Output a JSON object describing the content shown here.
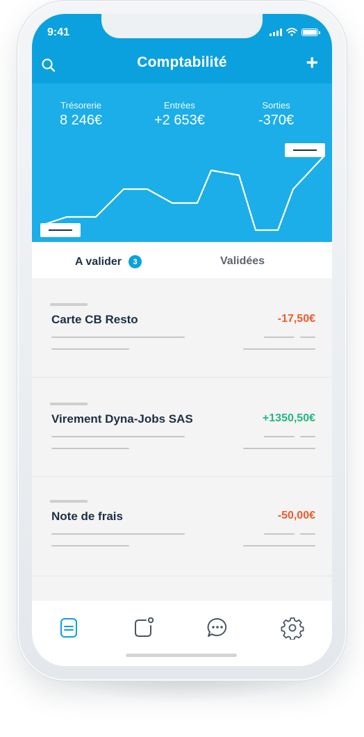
{
  "status_bar": {
    "time": "9:41"
  },
  "header": {
    "title": "Comptabilité"
  },
  "icons": {
    "search": "search-icon",
    "add": "plus-icon",
    "signal": "signal-icon",
    "wifi": "wifi-icon",
    "battery": "battery-icon"
  },
  "summary": {
    "tresorerie": {
      "label": "Trésorerie",
      "value": "8 246€"
    },
    "entrees": {
      "label": "Entrées",
      "value": "+2 653€"
    },
    "sorties": {
      "label": "Sorties",
      "value": "-370€"
    }
  },
  "tabs": {
    "active": {
      "label": "A valider",
      "badge": "3"
    },
    "inactive": {
      "label": "Validées"
    }
  },
  "transactions": [
    {
      "title": "Carte CB Resto",
      "amount": "-17,50€",
      "type": "negative"
    },
    {
      "title": "Virement Dyna-Jobs SAS",
      "amount": "+1350,50€",
      "type": "positive"
    },
    {
      "title": "Note de frais",
      "amount": "-50,00€",
      "type": "negative"
    }
  ],
  "bottom_nav": [
    "document-icon",
    "notification-square-icon",
    "chat-bubble-icon",
    "settings-gear-icon"
  ],
  "colors": {
    "header": "#0aa1de",
    "chart_bg": "#1baee8",
    "negative": "#f15a29",
    "positive": "#21b87d",
    "text_dark": "#1e2f44",
    "active_icon": "#0aa1de"
  }
}
